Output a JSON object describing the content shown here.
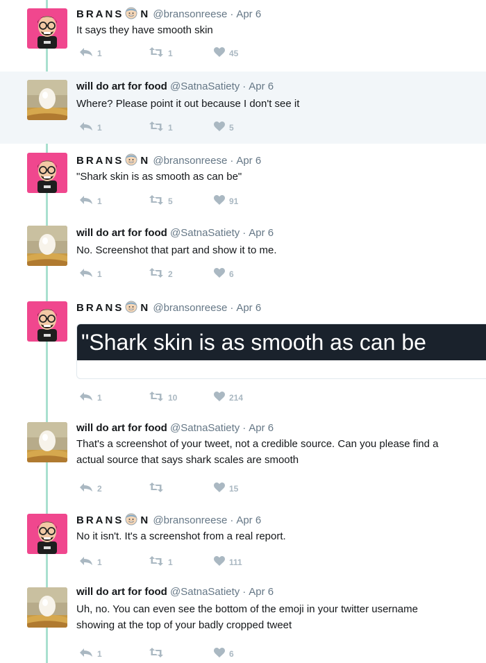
{
  "users": {
    "branson": {
      "name_left": "BRANS",
      "name_right": "N",
      "handle": "@bransonreese",
      "avatar_icon": "bitmoji-avatar-icon",
      "emoji_icon": "grinning-face-emoji-icon"
    },
    "satna": {
      "name": "will do art for food",
      "handle": "@SatnaSatiety",
      "avatar_icon": "egg-painting-avatar-icon"
    }
  },
  "tweets": [
    {
      "author": "branson",
      "date": "Apr 6",
      "lines": [
        "It says they have smooth skin"
      ],
      "replies": "1",
      "retweets": "1",
      "likes": "45",
      "highlighted": false
    },
    {
      "author": "satna",
      "date": "Apr 6",
      "lines": [
        "Where? Please point it out because I don't see it"
      ],
      "replies": "1",
      "retweets": "1",
      "likes": "5",
      "highlighted": true
    },
    {
      "author": "branson",
      "date": "Apr 6",
      "lines": [
        "\"Shark skin is as smooth as can be\""
      ],
      "replies": "1",
      "retweets": "5",
      "likes": "91",
      "highlighted": false
    },
    {
      "author": "satna",
      "date": "Apr 6",
      "lines": [
        "No. Screenshot that part and show it to me."
      ],
      "replies": "1",
      "retweets": "2",
      "likes": "6",
      "highlighted": false
    },
    {
      "author": "branson",
      "date": "Apr 6",
      "lines": [],
      "embed_text": "\"Shark skin is as smooth as can be",
      "replies": "1",
      "retweets": "10",
      "likes": "214",
      "highlighted": false
    },
    {
      "author": "satna",
      "date": "Apr 6",
      "lines": [
        "That's a screenshot of your tweet, not a credible source. Can you please find a",
        "actual source that says shark scales are smooth"
      ],
      "replies": "2",
      "retweets": "",
      "likes": "15",
      "highlighted": false
    },
    {
      "author": "branson",
      "date": "Apr 6",
      "lines": [
        "No it isn't. It's a screenshot from a real report."
      ],
      "replies": "1",
      "retweets": "1",
      "likes": "111",
      "highlighted": false
    },
    {
      "author": "satna",
      "date": "Apr 6",
      "lines": [
        "Uh, no. You can even see the bottom of the emoji in your twitter username",
        "showing at the top of your badly cropped tweet"
      ],
      "replies": "1",
      "retweets": "",
      "likes": "6",
      "highlighted": false
    }
  ],
  "separator": "·",
  "colors": {
    "thread_line": "#a9e0cf",
    "highlight_bg": "#f2f6f9",
    "action_gray": "#aab8c2",
    "secondary_text": "#657786",
    "avatar_pink": "#f0478e"
  }
}
